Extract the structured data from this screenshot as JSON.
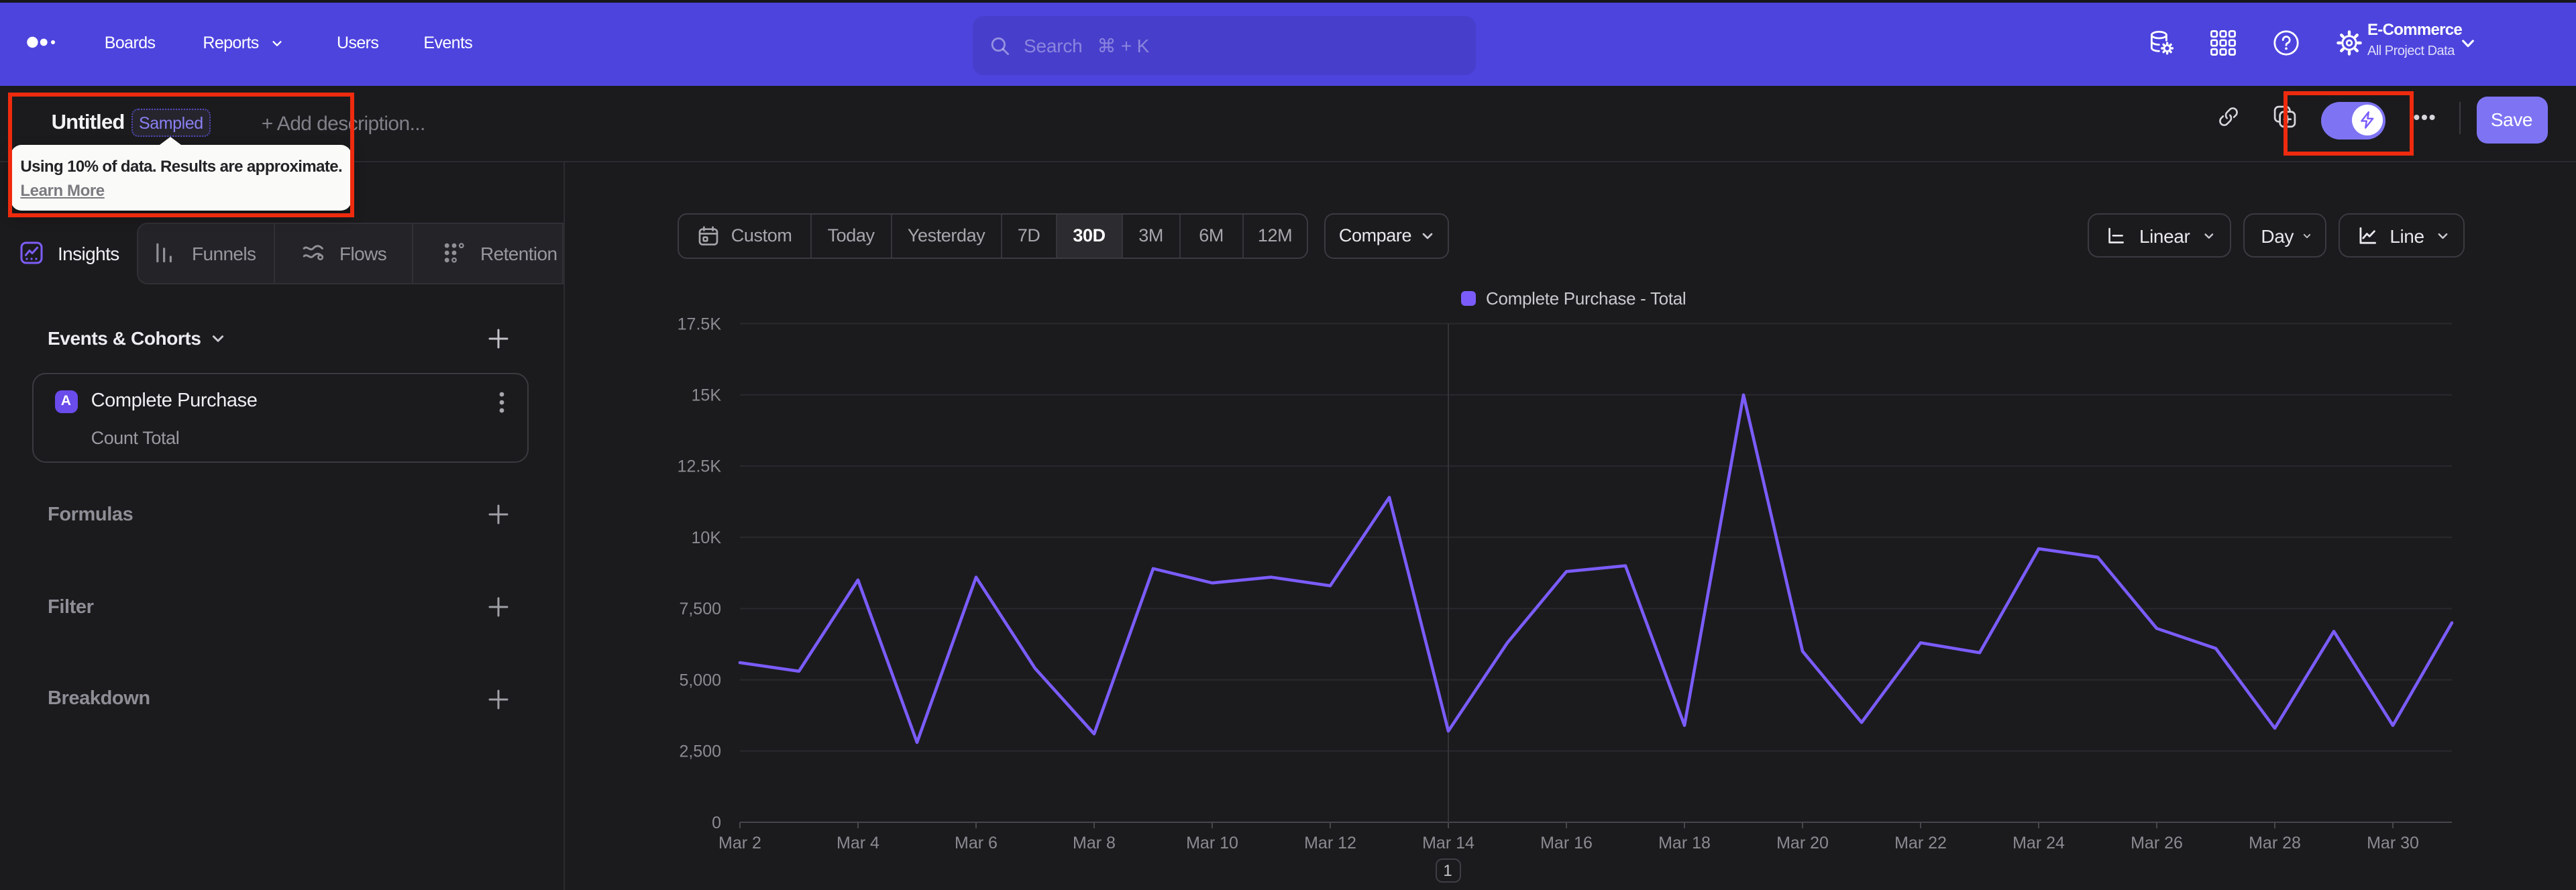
{
  "topnav": {
    "logo": "mixpanel-dots-logo",
    "items": [
      {
        "label": "Boards",
        "left": 77.9,
        "chevron": false
      },
      {
        "label": "Reports",
        "left": 151.2,
        "chevron": true
      },
      {
        "label": "Users",
        "left": 251,
        "chevron": false
      },
      {
        "label": "Events",
        "left": 315.7,
        "chevron": false
      }
    ],
    "search": {
      "placeholder": "Search",
      "shortcut": "⌘ + K"
    },
    "project": {
      "name": "E-Commerce",
      "scope": "All Project Data"
    }
  },
  "report_header": {
    "title": "Untitled",
    "badge": "Sampled",
    "add_description": "+ Add description...",
    "save_label": "Save",
    "sampling_tooltip": {
      "text": "Using 10% of data. Results are approximate.",
      "link": "Learn More"
    },
    "toggle_on": true
  },
  "tabs": [
    {
      "label": "Insights",
      "icon": "insights-icon",
      "active": true,
      "left": 15,
      "labelLeft": 42
    },
    {
      "label": "Funnels",
      "icon": "funnels-icon",
      "active": false,
      "left": 115,
      "labelLeft": 144
    },
    {
      "label": "Flows",
      "icon": "flows-icon",
      "active": false,
      "left": 225,
      "labelLeft": 253
    },
    {
      "label": "Retention",
      "icon": "retention-icon",
      "active": false,
      "left": 330,
      "labelLeft": 359
    }
  ],
  "builder": {
    "events_header": "Events & Cohorts",
    "event": {
      "letter": "A",
      "name": "Complete Purchase",
      "metric": "Count Total"
    },
    "rows": [
      {
        "label": "Formulas",
        "centerY": 383.5
      },
      {
        "label": "Filter",
        "centerY": 452.5
      },
      {
        "label": "Breakdown",
        "centerY": 521
      }
    ]
  },
  "controls": {
    "ranges": [
      {
        "label": "Custom",
        "width": 98.5,
        "icon": "calendar-icon",
        "active": false
      },
      {
        "label": "Today",
        "width": 60,
        "active": false
      },
      {
        "label": "Yesterday",
        "width": 82,
        "active": false
      },
      {
        "label": "7D",
        "width": 41,
        "active": false
      },
      {
        "label": "30D",
        "width": 49,
        "active": true
      },
      {
        "label": "3M",
        "width": 43,
        "active": false
      },
      {
        "label": "6M",
        "width": 47,
        "active": false
      },
      {
        "label": "12M",
        "width": 47,
        "active": false
      }
    ],
    "compare": "Compare",
    "scale": "Linear",
    "granularity": "Day",
    "chart_type": "Line"
  },
  "pagination": "1",
  "accent_colors": {
    "nav": "#4d44de",
    "line": "#7b5cfa",
    "button": "#7e74f3",
    "event_badge": "#6a4beb",
    "annotation": "#ee2b0e"
  },
  "chart_data": {
    "type": "line",
    "title": "",
    "legend": "Complete Purchase - Total",
    "series_color": "#7b5cfa",
    "x": [
      "Mar 2",
      "Mar 3",
      "Mar 4",
      "Mar 5",
      "Mar 6",
      "Mar 7",
      "Mar 8",
      "Mar 9",
      "Mar 10",
      "Mar 11",
      "Mar 12",
      "Mar 13",
      "Mar 14",
      "Mar 15",
      "Mar 16",
      "Mar 17",
      "Mar 18",
      "Mar 19",
      "Mar 20",
      "Mar 21",
      "Mar 22",
      "Mar 23",
      "Mar 24",
      "Mar 25",
      "Mar 26",
      "Mar 27",
      "Mar 28",
      "Mar 29",
      "Mar 30",
      "Mar 31"
    ],
    "values": [
      5600,
      5300,
      8500,
      2800,
      8600,
      5400,
      3100,
      8900,
      8400,
      8600,
      8300,
      11400,
      3200,
      6300,
      8800,
      9000,
      3400,
      15000,
      6000,
      3500,
      6300,
      5950,
      9600,
      9300,
      6800,
      6100,
      3300,
      6700,
      3400,
      7000
    ],
    "ylim": [
      0,
      17500
    ],
    "yticks": [
      {
        "value": 0,
        "label": "0"
      },
      {
        "value": 2500,
        "label": "2,500"
      },
      {
        "value": 5000,
        "label": "5,000"
      },
      {
        "value": 7500,
        "label": "7,500"
      },
      {
        "value": 10000,
        "label": "10K"
      },
      {
        "value": 12500,
        "label": "12.5K"
      },
      {
        "value": 15000,
        "label": "15K"
      },
      {
        "value": 17500,
        "label": "17.5K"
      }
    ],
    "xtick_every": 2,
    "grid": "horizontal",
    "vertical_gridline_at": "Mar 14",
    "legend_position": "top-center"
  }
}
